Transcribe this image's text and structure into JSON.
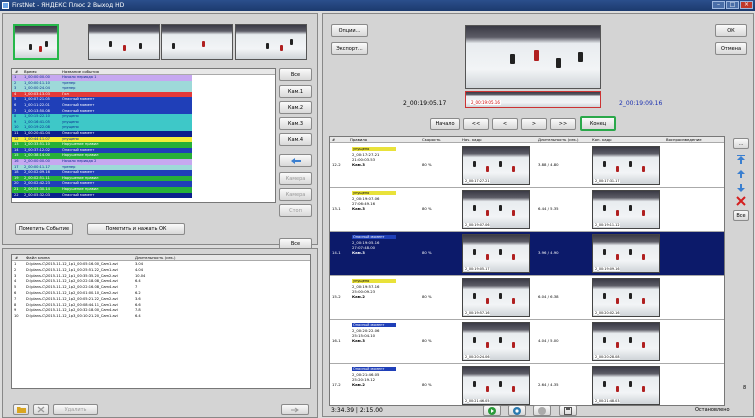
{
  "window": {
    "title": "FirstNet - ЯНДЕКС Плюс 2 Выход HD"
  },
  "left_list": {
    "headers": {
      "time": "Время",
      "event": "Название события"
    },
    "rows": [
      {
        "n": "1",
        "time": "1_00:00:00.00",
        "event": "Начало периода 1",
        "bg": "#c6a8f0",
        "fg": "#0a2a90"
      },
      {
        "n": "2",
        "time": "1_00:00:11.10",
        "event": "тренер",
        "bg": "#9ed9d9",
        "fg": "#0a2a90"
      },
      {
        "n": "3",
        "time": "1_00:00:24.04",
        "event": "тренер",
        "bg": "#9ed9d9",
        "fg": "#0a2a90"
      },
      {
        "n": "4",
        "time": "1_00:03:13.03",
        "event": "Гол",
        "bg": "#e23a3a",
        "fg": "#ffffff"
      },
      {
        "n": "5",
        "time": "1_00:07:21.05",
        "event": "Опасный момент",
        "bg": "#1f3fb8",
        "fg": "#ffffff"
      },
      {
        "n": "6",
        "time": "1_00:11:22.01",
        "event": "Опасный момент",
        "bg": "#1f3fb8",
        "fg": "#ffffff"
      },
      {
        "n": "7",
        "time": "1_00:13:50.08",
        "event": "Опасный момент",
        "bg": "#1f3fb8",
        "fg": "#ffffff"
      },
      {
        "n": "8",
        "time": "1_00:15:22.10",
        "event": "упущено",
        "bg": "#3ec8c8",
        "fg": "#0a2a90"
      },
      {
        "n": "9",
        "time": "1_00:16:41.05",
        "event": "упущено",
        "bg": "#3ec8c8",
        "fg": "#0a2a90"
      },
      {
        "n": "10",
        "time": "1_00:19:22.08",
        "event": "упущено",
        "bg": "#3ec8c8",
        "fg": "#0a2a90"
      },
      {
        "n": "11",
        "time": "1_00:20:41.04",
        "event": "Опасный момент",
        "bg": "#0b1f8c",
        "fg": "#ffffff"
      },
      {
        "n": "12",
        "time": "1_00:44:11.07",
        "event": "упущено",
        "bg": "#f2ee3a",
        "fg": "#0a2a90"
      },
      {
        "n": "13",
        "time": "1_00:33:51.10",
        "event": "Нарушение правил",
        "bg": "#27b038",
        "fg": "#ffffff"
      },
      {
        "n": "14",
        "time": "1_00:37:12.02",
        "event": "Опасный момент",
        "bg": "#1f3fb8",
        "fg": "#ffffff"
      },
      {
        "n": "15",
        "time": "1_00:38:14.00",
        "event": "Нарушение правил",
        "bg": "#27b038",
        "fg": "#ffffff"
      },
      {
        "n": "16",
        "time": "2_00:00:00.00",
        "event": "Начало периода 2",
        "bg": "#c6a8f0",
        "fg": "#0a2a90"
      },
      {
        "n": "17",
        "time": "2_00:00:11.17",
        "event": "тренер",
        "bg": "#9ed9d9",
        "fg": "#0a2a90"
      },
      {
        "n": "18",
        "time": "2_00:02:09.16",
        "event": "Опасный момент",
        "bg": "#1f3fb8",
        "fg": "#ffffff"
      },
      {
        "n": "19",
        "time": "2_00:02:51.11",
        "event": "Нарушение правил",
        "bg": "#27b038",
        "fg": "#ffffff"
      },
      {
        "n": "20",
        "time": "2_00:02:42.23",
        "event": "Опасный момент",
        "bg": "#1f3fb8",
        "fg": "#ffffff"
      },
      {
        "n": "21",
        "time": "2_00:03:30.14",
        "event": "Нарушение правил",
        "bg": "#27b038",
        "fg": "#ffffff"
      },
      {
        "n": "22",
        "time": "2_00:05:32.03",
        "event": "Опасный момент",
        "bg": "#0b1f8c",
        "fg": "#ffffff"
      }
    ]
  },
  "left_side_buttons": {
    "all": "Все",
    "cam1": "Кам.1",
    "cam2": "Кам.2",
    "cam3": "Кам.3",
    "cam4": "Кам.4",
    "disabled1": "Камера",
    "disabled2": "Камера",
    "disabled3": "Стоп",
    "all2": "Все"
  },
  "mark_buttons": {
    "mark_event": "Пометить Событие",
    "mark_ok": "Пометить и нажать ОК"
  },
  "file_list": {
    "headers": {
      "n": "#",
      "name": "Файл клипа",
      "duration": "Длительность (сек.)"
    },
    "rows": [
      {
        "n": "1",
        "name": "D:\\plans-C\\2015-11-12_1p1_00:05:16.00_Cam1.avi",
        "duration": "3.04"
      },
      {
        "n": "2",
        "name": "D:\\plans-C\\2015-11-12_1p1_00:25:51.22_Cam1.avi",
        "duration": "4.04"
      },
      {
        "n": "3",
        "name": "D:\\plans-C\\2015-11-12_1p1_00:35:35.20_Cam2.avi",
        "duration": "10.04"
      },
      {
        "n": "4",
        "name": "D:\\plans-C\\2015-11-12_1p2_00:22:18.08_Cam4.avi",
        "duration": "6.4"
      },
      {
        "n": "5",
        "name": "D:\\plans-C\\2015-11-12_1p2_00:22:16.08_Cam4.avi",
        "duration": "7"
      },
      {
        "n": "6",
        "name": "D:\\plans-C\\2015-11-12_1p2_00:01:00.10_Cam2.avi",
        "duration": "6.2"
      },
      {
        "n": "7",
        "name": "D:\\plans-C\\2015-11-12_1p2_00:05:21.22_Cam2.avi",
        "duration": "3.6"
      },
      {
        "n": "8",
        "name": "D:\\plans-C\\2015-11-12_1p2_00:08:44.11_Cam1.avi",
        "duration": "6.6"
      },
      {
        "n": "9",
        "name": "D:\\plans-C\\2015-11-12_1p2_00:32:18.00_Cam4.avi",
        "duration": "7.8"
      },
      {
        "n": "10",
        "name": "D:\\plans-C\\2015-11-12_1p3_00:10:21.20_Cam1.avi",
        "duration": "6.4"
      }
    ]
  },
  "bottom_left_buttons": {
    "disabled_label": "Удалить"
  },
  "right_top": {
    "options": "Опции...",
    "export": "Экспорт...",
    "ok": "ОК",
    "cancel": "Отмена",
    "time_in": "2_00:19:05.17",
    "time_out": "2_00:19:09.16",
    "frame_in_tc": "2_00:19:05.16"
  },
  "transport": {
    "start": "Начало",
    "prev2": "<<",
    "prev": "<",
    "next": ">",
    "next2": ">>",
    "end": "Конец"
  },
  "clip_table": {
    "headers": {
      "n": "#",
      "moment": "Правило",
      "speed": "Скорость",
      "start_frame": "Нач. кадр",
      "duration": "Длительность (сек.)",
      "end_frame": "Кон. кадр",
      "playback": "Воспроизведение"
    },
    "rows": [
      {
        "n": "12-2",
        "label": "упущено",
        "label_bg": "#e9e23a",
        "t1": "2_00:17:27.21",
        "t2": "21:00:03.53",
        "cam": "Кам.3",
        "speed": "80 %",
        "tc_start": "2_00:17:27.21",
        "duration": "3.88 / 4.80",
        "tc_end": "2_00:17:31.17",
        "sel": false
      },
      {
        "n": "13-1",
        "label": "упущено",
        "label_bg": "#e9e23a",
        "t1": "2_00:19:07.06",
        "t2": "27:06:49.16",
        "cam": "Кам.3",
        "speed": "80 %",
        "tc_start": "2_00:19:07.06",
        "duration": "6.44 / 5.35",
        "tc_end": "2_00:19:11.12",
        "sel": false
      },
      {
        "n": "14-1",
        "label": "Опасный момент",
        "label_bg": "#1f3fb8",
        "t1": "2_00:19:05.16",
        "t2": "27:07:48.00",
        "cam": "Кам.3",
        "speed": "80 %",
        "tc_start": "2_00:19:05.17",
        "duration": "3.96 / 4.90",
        "tc_end": "2_00:19:09.16",
        "sel": true
      },
      {
        "n": "15-2",
        "label": "упущено",
        "label_bg": "#e9e23a",
        "t1": "2_00:19:57.16",
        "t2": "25:00:09.23",
        "cam": "Кам.2",
        "speed": "80 %",
        "tc_start": "2_00:19:57.16",
        "duration": "6.04 / 6.38",
        "tc_end": "2_00:20:02.16",
        "sel": false
      },
      {
        "n": "16-1",
        "label": "Опасный момент",
        "label_bg": "#1f3fb8",
        "t1": "2_00:20:22.06",
        "t2": "25:15:04.10",
        "cam": "Кам.3",
        "speed": "80 %",
        "tc_start": "2_00:20:24.06",
        "duration": "4.04 / 5.00",
        "tc_end": "2_00:20:28.08",
        "sel": false
      },
      {
        "n": "17-2",
        "label": "Опасный момент",
        "label_bg": "#1f3fb8",
        "t1": "2_00:21:46.05",
        "t2": "25:20:19.12",
        "cam": "Кам.2",
        "speed": "80 %",
        "tc_start": "2_00:21:46.05",
        "duration": "2.64 / 4.35",
        "tc_end": "2_00:21:48.03",
        "sel": false
      }
    ]
  },
  "right_side": {
    "dots": "...",
    "all": "Все",
    "count": "8"
  },
  "status": {
    "time": "3:34.39 | 2:15.00",
    "state": "Остановлено"
  }
}
